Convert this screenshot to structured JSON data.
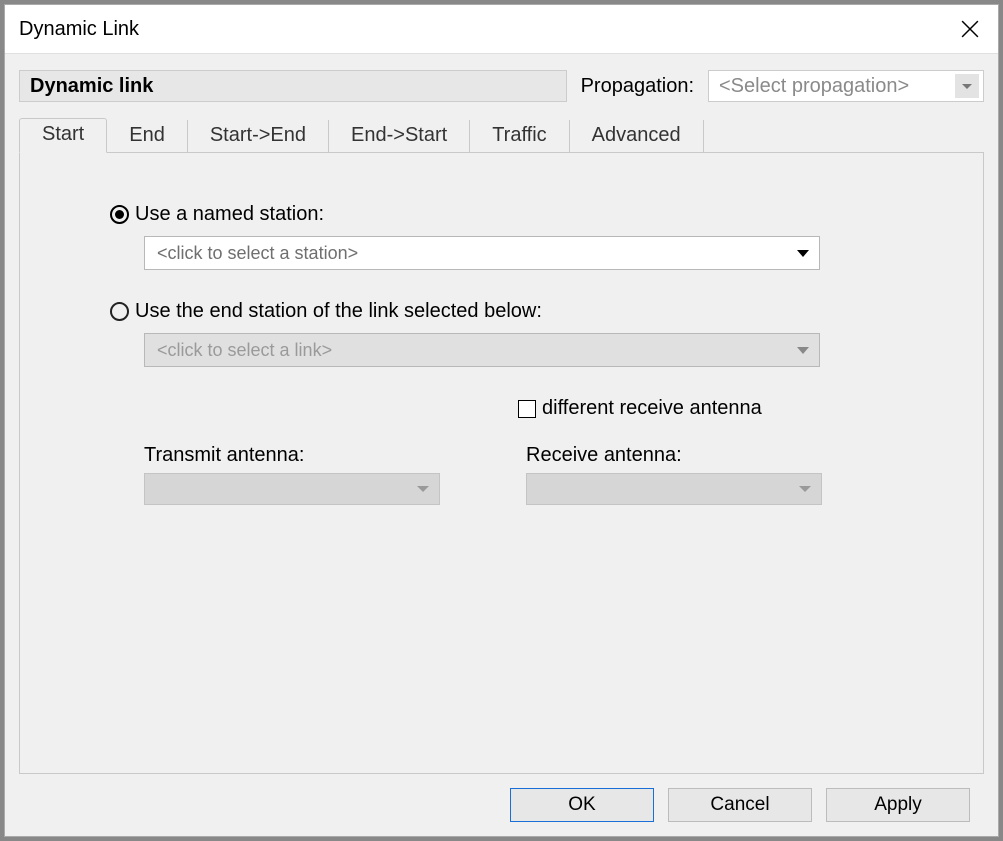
{
  "window": {
    "title": "Dynamic Link"
  },
  "header": {
    "link_name": "Dynamic link",
    "propagation_label": "Propagation:",
    "propagation_placeholder": "<Select propagation>"
  },
  "tabs": [
    {
      "label": "Start",
      "active": true
    },
    {
      "label": "End",
      "active": false
    },
    {
      "label": "Start->End",
      "active": false
    },
    {
      "label": "End->Start",
      "active": false
    },
    {
      "label": "Traffic",
      "active": false
    },
    {
      "label": "Advanced",
      "active": false
    }
  ],
  "start_tab": {
    "radio_named_label": "Use a named station:",
    "station_placeholder": "<click to select a station>",
    "radio_endlink_label": "Use the end station of the link selected below:",
    "link_placeholder": "<click to select a link>",
    "diff_receive_label": "different receive antenna",
    "transmit_label": "Transmit antenna:",
    "receive_label": "Receive antenna:"
  },
  "footer": {
    "ok": "OK",
    "cancel": "Cancel",
    "apply": "Apply"
  }
}
